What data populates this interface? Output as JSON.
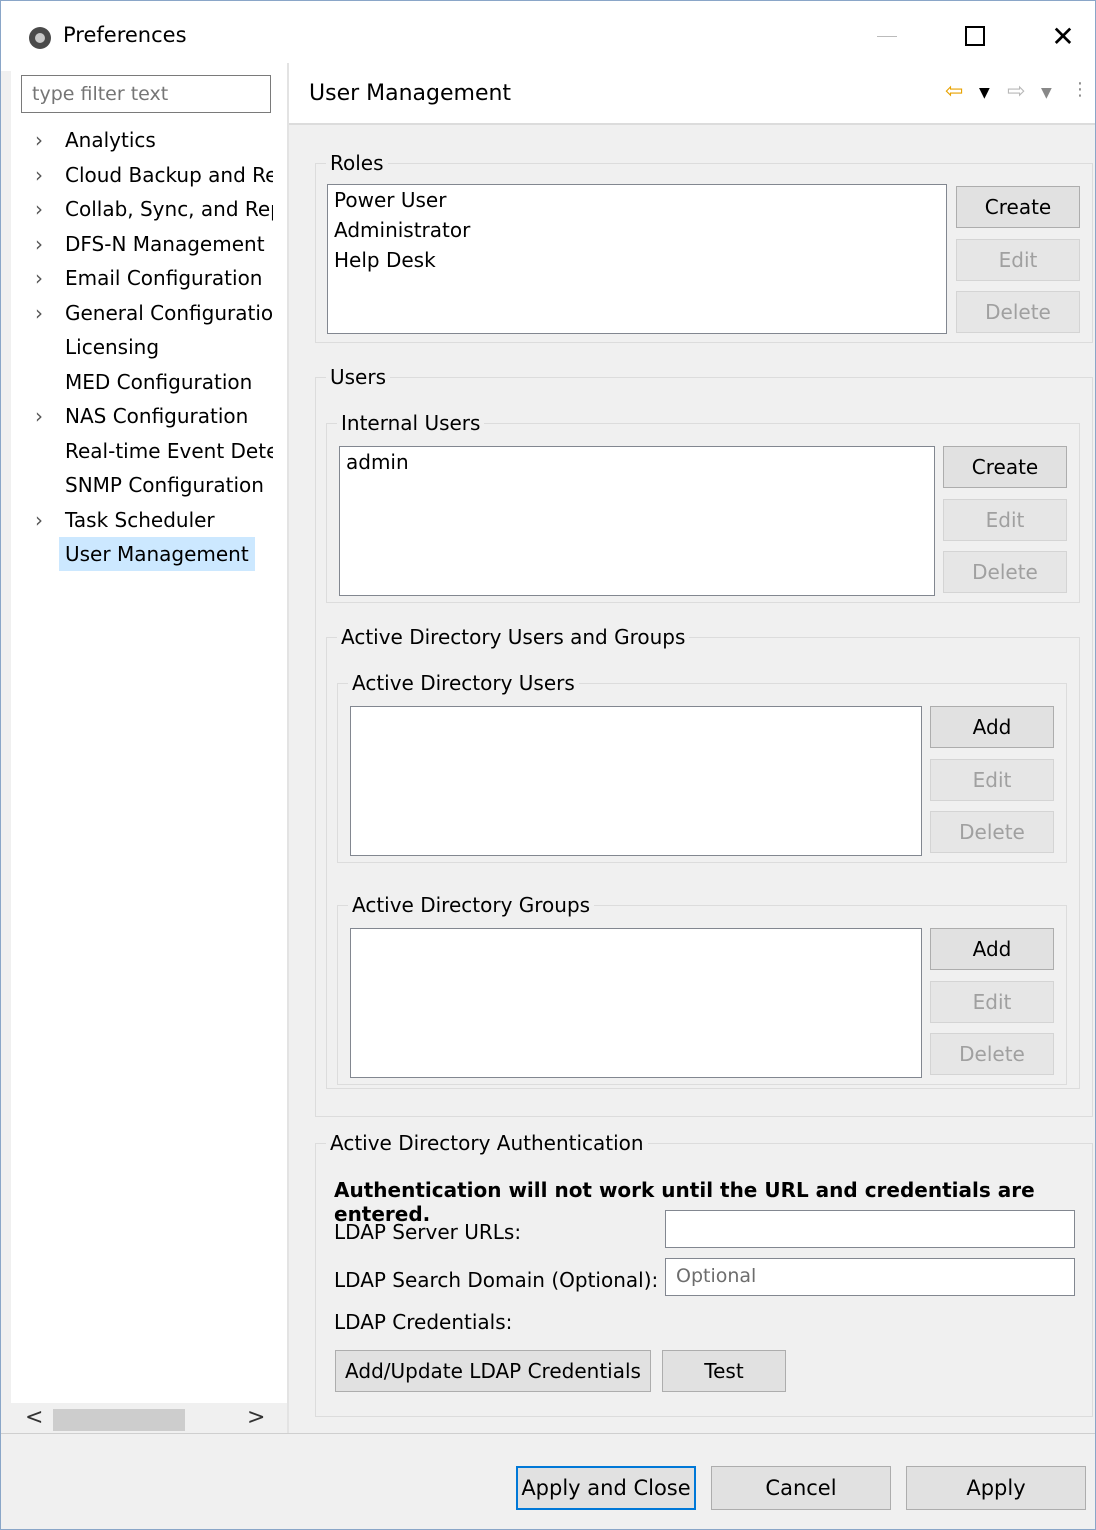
{
  "window": {
    "title": "Preferences"
  },
  "filter": {
    "placeholder": "type filter text"
  },
  "tree": {
    "items": [
      {
        "label": "Analytics",
        "expandable": true
      },
      {
        "label": "Cloud Backup and Re",
        "expandable": true
      },
      {
        "label": "Collab, Sync, and Rep",
        "expandable": true
      },
      {
        "label": "DFS-N Management",
        "expandable": true
      },
      {
        "label": "Email Configuration",
        "expandable": true
      },
      {
        "label": "General Configuratio",
        "expandable": true
      },
      {
        "label": "Licensing",
        "expandable": false
      },
      {
        "label": "MED Configuration",
        "expandable": false
      },
      {
        "label": "NAS Configuration",
        "expandable": true
      },
      {
        "label": "Real-time Event Dete",
        "expandable": false
      },
      {
        "label": "SNMP Configuration",
        "expandable": false
      },
      {
        "label": "Task Scheduler",
        "expandable": true
      },
      {
        "label": "User Management",
        "expandable": false,
        "selected": true
      }
    ]
  },
  "page": {
    "title": "User Management"
  },
  "roles": {
    "label": "Roles",
    "items": [
      "Power User",
      "Administrator",
      "Help Desk"
    ],
    "create": "Create",
    "edit": "Edit",
    "delete": "Delete"
  },
  "users": {
    "label": "Users",
    "internal": {
      "label": "Internal Users",
      "items": [
        "admin"
      ],
      "create": "Create",
      "edit": "Edit",
      "delete": "Delete"
    },
    "ad": {
      "label": "Active Directory Users and Groups",
      "users": {
        "label": "Active Directory Users",
        "add": "Add",
        "edit": "Edit",
        "delete": "Delete"
      },
      "groups": {
        "label": "Active Directory Groups",
        "add": "Add",
        "edit": "Edit",
        "delete": "Delete"
      }
    }
  },
  "auth": {
    "label": "Active Directory Authentication",
    "warning": "Authentication will not work until the URL and credentials are entered.",
    "ldap_urls_label": "LDAP Server URLs:",
    "ldap_urls_value": "",
    "search_domain_label": "LDAP Search Domain (Optional):",
    "search_domain_placeholder": "Optional",
    "credentials_label": "LDAP Credentials:",
    "update_credentials": "Add/Update LDAP Credentials",
    "test": "Test"
  },
  "footer": {
    "apply_close": "Apply and Close",
    "cancel": "Cancel",
    "apply": "Apply"
  }
}
